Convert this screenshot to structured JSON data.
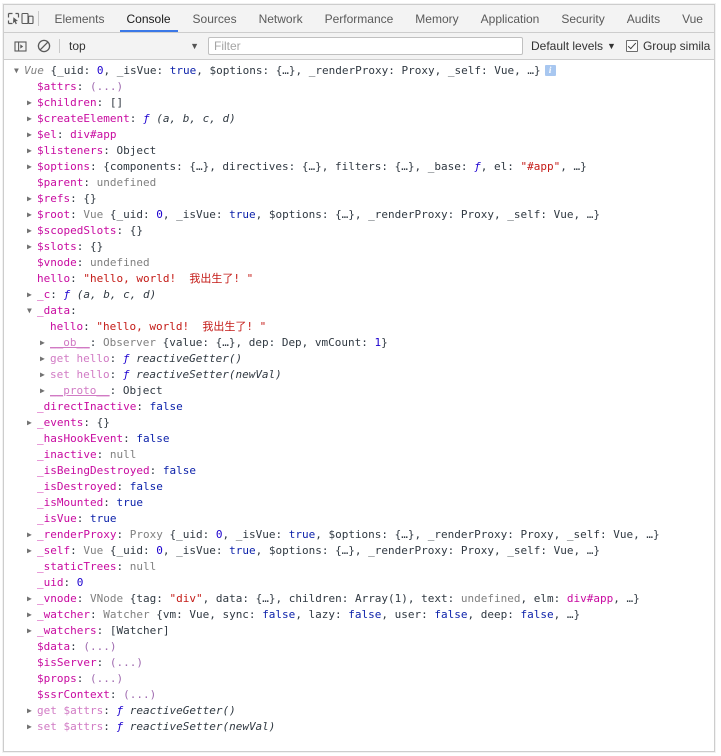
{
  "tabbar": {
    "icons": [
      {
        "name": "inspect-element-icon",
        "title": "Inspect element"
      },
      {
        "name": "device-toolbar-icon",
        "title": "Toggle device toolbar"
      }
    ],
    "tabs": [
      {
        "label": "Elements",
        "active": false
      },
      {
        "label": "Console",
        "active": true
      },
      {
        "label": "Sources",
        "active": false
      },
      {
        "label": "Network",
        "active": false
      },
      {
        "label": "Performance",
        "active": false
      },
      {
        "label": "Memory",
        "active": false
      },
      {
        "label": "Application",
        "active": false
      },
      {
        "label": "Security",
        "active": false
      },
      {
        "label": "Audits",
        "active": false
      },
      {
        "label": "Vue",
        "active": false
      }
    ]
  },
  "filterbar": {
    "sidebar_toggle_icon": "console-sidebar-icon",
    "clear_icon": "clear-console-icon",
    "context": "top",
    "context_caret": "▼",
    "filter_placeholder": "Filter",
    "filter_value": "",
    "levels_label": "Default levels",
    "levels_caret": "▼",
    "group_similar_label": "Group simila",
    "group_similar_checked": true
  },
  "console": {
    "info_badge": "i",
    "rows": [
      {
        "indent": 0,
        "arrow": "open",
        "tokens": [
          {
            "t": "Vue ",
            "c": "cls"
          },
          {
            "t": "{_uid: ",
            "c": "punct"
          },
          {
            "t": "0",
            "c": "num"
          },
          {
            "t": ", _isVue: ",
            "c": "punct"
          },
          {
            "t": "true",
            "c": "bool"
          },
          {
            "t": ", $options: {…}, _renderProxy: Proxy, _self: Vue, …}",
            "c": "punct"
          }
        ],
        "badge": true
      },
      {
        "indent": 1,
        "arrow": "none",
        "tokens": [
          {
            "t": "$attrs",
            "c": "prop"
          },
          {
            "t": ": ",
            "c": "punct"
          },
          {
            "t": "(...)",
            "c": "dots"
          }
        ]
      },
      {
        "indent": 1,
        "arrow": "closed",
        "tokens": [
          {
            "t": "$children",
            "c": "prop"
          },
          {
            "t": ": []",
            "c": "punct"
          }
        ]
      },
      {
        "indent": 1,
        "arrow": "closed",
        "tokens": [
          {
            "t": "$createElement",
            "c": "prop"
          },
          {
            "t": ": ",
            "c": "punct"
          },
          {
            "t": "ƒ",
            "c": "fnkw"
          },
          {
            "t": " (a, b, c, d)",
            "c": "fnsig"
          }
        ]
      },
      {
        "indent": 1,
        "arrow": "closed",
        "tokens": [
          {
            "t": "$el",
            "c": "prop"
          },
          {
            "t": ": ",
            "c": "punct"
          },
          {
            "t": "div#app",
            "c": "node"
          }
        ]
      },
      {
        "indent": 1,
        "arrow": "closed",
        "tokens": [
          {
            "t": "$listeners",
            "c": "prop"
          },
          {
            "t": ": ",
            "c": "punct"
          },
          {
            "t": "Object",
            "c": "objname"
          }
        ]
      },
      {
        "indent": 1,
        "arrow": "closed",
        "tokens": [
          {
            "t": "$options",
            "c": "prop"
          },
          {
            "t": ": {components: {…}, directives: {…}, filters: {…}, _base: ",
            "c": "punct"
          },
          {
            "t": "ƒ",
            "c": "fnkw"
          },
          {
            "t": ", el: ",
            "c": "punct"
          },
          {
            "t": "\"#app\"",
            "c": "str"
          },
          {
            "t": ", …}",
            "c": "punct"
          }
        ]
      },
      {
        "indent": 1,
        "arrow": "none",
        "tokens": [
          {
            "t": "$parent",
            "c": "prop"
          },
          {
            "t": ": ",
            "c": "punct"
          },
          {
            "t": "undefined",
            "c": "undef"
          }
        ]
      },
      {
        "indent": 1,
        "arrow": "closed",
        "tokens": [
          {
            "t": "$refs",
            "c": "prop"
          },
          {
            "t": ": {}",
            "c": "punct"
          }
        ]
      },
      {
        "indent": 1,
        "arrow": "closed",
        "tokens": [
          {
            "t": "$root",
            "c": "prop"
          },
          {
            "t": ": ",
            "c": "punct"
          },
          {
            "t": "Vue ",
            "c": "cls-plain"
          },
          {
            "t": "{_uid: ",
            "c": "punct"
          },
          {
            "t": "0",
            "c": "num"
          },
          {
            "t": ", _isVue: ",
            "c": "punct"
          },
          {
            "t": "true",
            "c": "bool"
          },
          {
            "t": ", $options: {…}, _renderProxy: Proxy, _self: Vue, …}",
            "c": "punct"
          }
        ]
      },
      {
        "indent": 1,
        "arrow": "closed",
        "tokens": [
          {
            "t": "$scopedSlots",
            "c": "prop"
          },
          {
            "t": ": {}",
            "c": "punct"
          }
        ]
      },
      {
        "indent": 1,
        "arrow": "closed",
        "tokens": [
          {
            "t": "$slots",
            "c": "prop"
          },
          {
            "t": ": {}",
            "c": "punct"
          }
        ]
      },
      {
        "indent": 1,
        "arrow": "none",
        "tokens": [
          {
            "t": "$vnode",
            "c": "prop"
          },
          {
            "t": ": ",
            "c": "punct"
          },
          {
            "t": "undefined",
            "c": "undef"
          }
        ]
      },
      {
        "indent": 1,
        "arrow": "none",
        "tokens": [
          {
            "t": "hello",
            "c": "prop"
          },
          {
            "t": ": ",
            "c": "punct"
          },
          {
            "t": "\"hello, world!  我出生了! \"",
            "c": "str"
          }
        ]
      },
      {
        "indent": 1,
        "arrow": "closed",
        "tokens": [
          {
            "t": "_c",
            "c": "prop"
          },
          {
            "t": ": ",
            "c": "punct"
          },
          {
            "t": "ƒ",
            "c": "fnkw"
          },
          {
            "t": " (a, b, c, d)",
            "c": "fnsig"
          }
        ]
      },
      {
        "indent": 1,
        "arrow": "open",
        "tokens": [
          {
            "t": "_data",
            "c": "prop"
          },
          {
            "t": ":",
            "c": "punct"
          }
        ]
      },
      {
        "indent": 2,
        "arrow": "none",
        "tokens": [
          {
            "t": "hello",
            "c": "prop"
          },
          {
            "t": ": ",
            "c": "punct"
          },
          {
            "t": "\"hello, world!  我出生了! \"",
            "c": "str"
          }
        ]
      },
      {
        "indent": 2,
        "arrow": "closed",
        "tokens": [
          {
            "t": "__ob__",
            "c": "prop-dim ul"
          },
          {
            "t": ": ",
            "c": "punct"
          },
          {
            "t": "Observer ",
            "c": "cls-plain"
          },
          {
            "t": "{value: {…}, dep: Dep, vmCount: ",
            "c": "punct"
          },
          {
            "t": "1",
            "c": "num"
          },
          {
            "t": "}",
            "c": "punct"
          }
        ]
      },
      {
        "indent": 2,
        "arrow": "closed",
        "tokens": [
          {
            "t": "get hello",
            "c": "prop-dim"
          },
          {
            "t": ": ",
            "c": "punct"
          },
          {
            "t": "ƒ",
            "c": "fnkw"
          },
          {
            "t": " reactiveGetter()",
            "c": "fnsig"
          }
        ]
      },
      {
        "indent": 2,
        "arrow": "closed",
        "tokens": [
          {
            "t": "set hello",
            "c": "prop-dim"
          },
          {
            "t": ": ",
            "c": "punct"
          },
          {
            "t": "ƒ",
            "c": "fnkw"
          },
          {
            "t": " reactiveSetter(newVal)",
            "c": "fnsig"
          }
        ]
      },
      {
        "indent": 2,
        "arrow": "closed",
        "tokens": [
          {
            "t": "__proto__",
            "c": "prop-dim ul"
          },
          {
            "t": ": ",
            "c": "punct"
          },
          {
            "t": "Object",
            "c": "objname"
          }
        ]
      },
      {
        "indent": 1,
        "arrow": "none",
        "tokens": [
          {
            "t": "_directInactive",
            "c": "prop"
          },
          {
            "t": ": ",
            "c": "punct"
          },
          {
            "t": "false",
            "c": "bool"
          }
        ]
      },
      {
        "indent": 1,
        "arrow": "closed",
        "tokens": [
          {
            "t": "_events",
            "c": "prop"
          },
          {
            "t": ": {}",
            "c": "punct"
          }
        ]
      },
      {
        "indent": 1,
        "arrow": "none",
        "tokens": [
          {
            "t": "_hasHookEvent",
            "c": "prop"
          },
          {
            "t": ": ",
            "c": "punct"
          },
          {
            "t": "false",
            "c": "bool"
          }
        ]
      },
      {
        "indent": 1,
        "arrow": "none",
        "tokens": [
          {
            "t": "_inactive",
            "c": "prop"
          },
          {
            "t": ": ",
            "c": "punct"
          },
          {
            "t": "null",
            "c": "undef"
          }
        ]
      },
      {
        "indent": 1,
        "arrow": "none",
        "tokens": [
          {
            "t": "_isBeingDestroyed",
            "c": "prop"
          },
          {
            "t": ": ",
            "c": "punct"
          },
          {
            "t": "false",
            "c": "bool"
          }
        ]
      },
      {
        "indent": 1,
        "arrow": "none",
        "tokens": [
          {
            "t": "_isDestroyed",
            "c": "prop"
          },
          {
            "t": ": ",
            "c": "punct"
          },
          {
            "t": "false",
            "c": "bool"
          }
        ]
      },
      {
        "indent": 1,
        "arrow": "none",
        "tokens": [
          {
            "t": "_isMounted",
            "c": "prop"
          },
          {
            "t": ": ",
            "c": "punct"
          },
          {
            "t": "true",
            "c": "bool"
          }
        ]
      },
      {
        "indent": 1,
        "arrow": "none",
        "tokens": [
          {
            "t": "_isVue",
            "c": "prop"
          },
          {
            "t": ": ",
            "c": "punct"
          },
          {
            "t": "true",
            "c": "bool"
          }
        ]
      },
      {
        "indent": 1,
        "arrow": "closed",
        "tokens": [
          {
            "t": "_renderProxy",
            "c": "prop"
          },
          {
            "t": ": ",
            "c": "punct"
          },
          {
            "t": "Proxy ",
            "c": "cls-plain"
          },
          {
            "t": "{_uid: ",
            "c": "punct"
          },
          {
            "t": "0",
            "c": "num"
          },
          {
            "t": ", _isVue: ",
            "c": "punct"
          },
          {
            "t": "true",
            "c": "bool"
          },
          {
            "t": ", $options: {…}, _renderProxy: Proxy, _self: Vue, …}",
            "c": "punct"
          }
        ]
      },
      {
        "indent": 1,
        "arrow": "closed",
        "tokens": [
          {
            "t": "_self",
            "c": "prop"
          },
          {
            "t": ": ",
            "c": "punct"
          },
          {
            "t": "Vue ",
            "c": "cls-plain"
          },
          {
            "t": "{_uid: ",
            "c": "punct"
          },
          {
            "t": "0",
            "c": "num"
          },
          {
            "t": ", _isVue: ",
            "c": "punct"
          },
          {
            "t": "true",
            "c": "bool"
          },
          {
            "t": ", $options: {…}, _renderProxy: Proxy, _self: Vue, …}",
            "c": "punct"
          }
        ]
      },
      {
        "indent": 1,
        "arrow": "none",
        "tokens": [
          {
            "t": "_staticTrees",
            "c": "prop"
          },
          {
            "t": ": ",
            "c": "punct"
          },
          {
            "t": "null",
            "c": "undef"
          }
        ]
      },
      {
        "indent": 1,
        "arrow": "none",
        "tokens": [
          {
            "t": "_uid",
            "c": "prop"
          },
          {
            "t": ": ",
            "c": "punct"
          },
          {
            "t": "0",
            "c": "num"
          }
        ]
      },
      {
        "indent": 1,
        "arrow": "closed",
        "tokens": [
          {
            "t": "_vnode",
            "c": "prop"
          },
          {
            "t": ": ",
            "c": "punct"
          },
          {
            "t": "VNode ",
            "c": "cls-plain"
          },
          {
            "t": "{tag: ",
            "c": "punct"
          },
          {
            "t": "\"div\"",
            "c": "str"
          },
          {
            "t": ", data: {…}, children: Array(1), text: ",
            "c": "punct"
          },
          {
            "t": "undefined",
            "c": "undef"
          },
          {
            "t": ", elm: ",
            "c": "punct"
          },
          {
            "t": "div#app",
            "c": "node"
          },
          {
            "t": ", …}",
            "c": "punct"
          }
        ]
      },
      {
        "indent": 1,
        "arrow": "closed",
        "tokens": [
          {
            "t": "_watcher",
            "c": "prop"
          },
          {
            "t": ": ",
            "c": "punct"
          },
          {
            "t": "Watcher ",
            "c": "cls-plain"
          },
          {
            "t": "{vm: Vue, sync: ",
            "c": "punct"
          },
          {
            "t": "false",
            "c": "bool"
          },
          {
            "t": ", lazy: ",
            "c": "punct"
          },
          {
            "t": "false",
            "c": "bool"
          },
          {
            "t": ", user: ",
            "c": "punct"
          },
          {
            "t": "false",
            "c": "bool"
          },
          {
            "t": ", deep: ",
            "c": "punct"
          },
          {
            "t": "false",
            "c": "bool"
          },
          {
            "t": ", …}",
            "c": "punct"
          }
        ]
      },
      {
        "indent": 1,
        "arrow": "closed",
        "tokens": [
          {
            "t": "_watchers",
            "c": "prop"
          },
          {
            "t": ": [Watcher]",
            "c": "punct"
          }
        ]
      },
      {
        "indent": 1,
        "arrow": "none",
        "tokens": [
          {
            "t": "$data",
            "c": "prop"
          },
          {
            "t": ": ",
            "c": "punct"
          },
          {
            "t": "(...)",
            "c": "dots"
          }
        ]
      },
      {
        "indent": 1,
        "arrow": "none",
        "tokens": [
          {
            "t": "$isServer",
            "c": "prop"
          },
          {
            "t": ": ",
            "c": "punct"
          },
          {
            "t": "(...)",
            "c": "dots"
          }
        ]
      },
      {
        "indent": 1,
        "arrow": "none",
        "tokens": [
          {
            "t": "$props",
            "c": "prop"
          },
          {
            "t": ": ",
            "c": "punct"
          },
          {
            "t": "(...)",
            "c": "dots"
          }
        ]
      },
      {
        "indent": 1,
        "arrow": "none",
        "tokens": [
          {
            "t": "$ssrContext",
            "c": "prop"
          },
          {
            "t": ": ",
            "c": "punct"
          },
          {
            "t": "(...)",
            "c": "dots"
          }
        ]
      },
      {
        "indent": 1,
        "arrow": "closed",
        "tokens": [
          {
            "t": "get $attrs",
            "c": "prop-dim"
          },
          {
            "t": ": ",
            "c": "punct"
          },
          {
            "t": "ƒ",
            "c": "fnkw"
          },
          {
            "t": " reactiveGetter()",
            "c": "fnsig"
          }
        ]
      },
      {
        "indent": 1,
        "arrow": "closed",
        "tokens": [
          {
            "t": "set $attrs",
            "c": "prop-dim"
          },
          {
            "t": ": ",
            "c": "punct"
          },
          {
            "t": "ƒ",
            "c": "fnkw"
          },
          {
            "t": " reactiveSetter(newVal)",
            "c": "fnsig"
          }
        ]
      }
    ]
  }
}
